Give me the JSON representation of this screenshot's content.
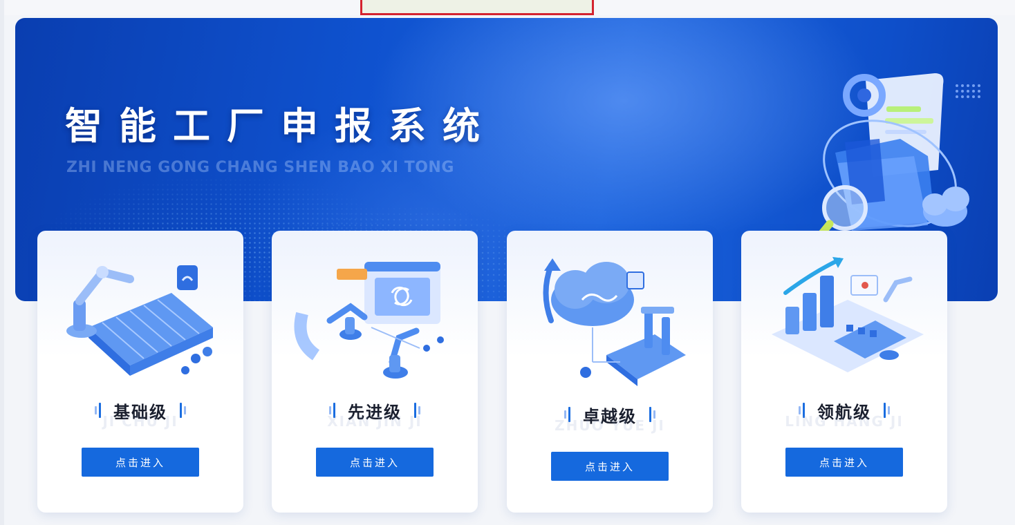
{
  "banner": {
    "title": "智能工厂申报系统",
    "subtitle": "ZHI NENG GONG CHANG SHEN BAO XI TONG"
  },
  "cards": [
    {
      "level": "基础级",
      "ghost": "JI CHU JI",
      "button": "点击进入",
      "icon": "robot-arm-conveyor-icon"
    },
    {
      "level": "先进级",
      "ghost": "XIAN JIN JI",
      "button": "点击进入",
      "icon": "automation-screen-icon"
    },
    {
      "level": "卓越级",
      "ghost": "ZHUO YUE JI",
      "button": "点击进入",
      "icon": "cloud-factory-icon"
    },
    {
      "level": "领航级",
      "ghost": "LING HANG JI",
      "button": "点击进入",
      "icon": "growth-chart-factory-icon"
    }
  ],
  "colors": {
    "banner": "#0f52cf",
    "button": "#1569de",
    "highlight_border": "#d4232f"
  }
}
